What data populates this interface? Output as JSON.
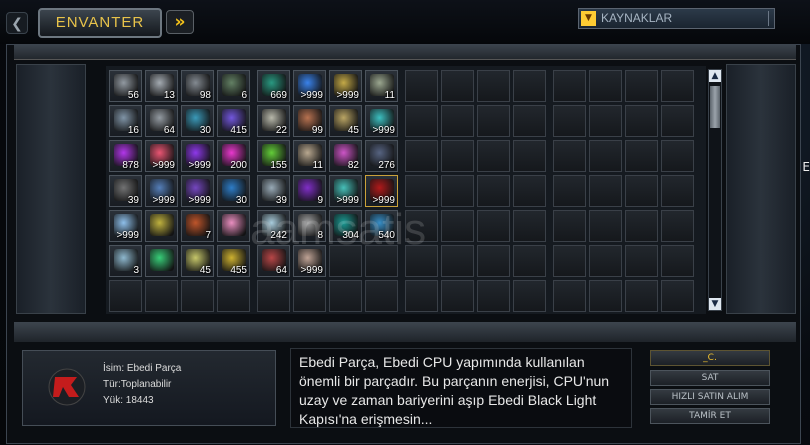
{
  "header": {
    "back_icon": "chevron-left-icon",
    "tab_label": "ENVANTER",
    "forward_icon": "double-chevron-right-icon",
    "dropdown_selected": "KAYNAKLAR"
  },
  "grid": {
    "columns": 16,
    "rows": 7,
    "items": [
      {
        "cell": 0,
        "count": "56",
        "color": "#9ea6ae"
      },
      {
        "cell": 1,
        "count": "13",
        "color": "#b2b9c0"
      },
      {
        "cell": 2,
        "count": "98",
        "color": "#8e959c"
      },
      {
        "cell": 3,
        "count": "6",
        "color": "#6a8a6a"
      },
      {
        "cell": 4,
        "count": "669",
        "color": "#2aa58a"
      },
      {
        "cell": 5,
        "count": ">999",
        "color": "#3c8cff"
      },
      {
        "cell": 6,
        "count": ">999",
        "color": "#d6b84a"
      },
      {
        "cell": 7,
        "count": "11",
        "color": "#a8b59a"
      },
      {
        "cell": 16,
        "count": "16",
        "color": "#8aa0b4"
      },
      {
        "cell": 17,
        "count": "64",
        "color": "#a0a7ae"
      },
      {
        "cell": 18,
        "count": "30",
        "color": "#3da6c8"
      },
      {
        "cell": 19,
        "count": "415",
        "color": "#7b5cf0"
      },
      {
        "cell": 20,
        "count": "22",
        "color": "#c8c8b8"
      },
      {
        "cell": 21,
        "count": "99",
        "color": "#c87a54"
      },
      {
        "cell": 22,
        "count": "45",
        "color": "#cbb36a"
      },
      {
        "cell": 23,
        "count": ">999",
        "color": "#3fd0d0"
      },
      {
        "cell": 32,
        "count": "878",
        "color": "#c238ff"
      },
      {
        "cell": 33,
        "count": ">999",
        "color": "#ff5a7a"
      },
      {
        "cell": 34,
        "count": ">999",
        "color": "#9a3aff"
      },
      {
        "cell": 35,
        "count": "200",
        "color": "#ff3ae0"
      },
      {
        "cell": 36,
        "count": "155",
        "color": "#6adf3a"
      },
      {
        "cell": 37,
        "count": "11",
        "color": "#c9b69a"
      },
      {
        "cell": 38,
        "count": "82",
        "color": "#e05ad8"
      },
      {
        "cell": 39,
        "count": "276",
        "color": "#5c6a8a"
      },
      {
        "cell": 48,
        "count": "39",
        "color": "#7a7a7a"
      },
      {
        "cell": 49,
        "count": ">999",
        "color": "#5a88c8"
      },
      {
        "cell": 50,
        "count": ">999",
        "color": "#7e4ad0"
      },
      {
        "cell": 51,
        "count": "30",
        "color": "#2f86d8"
      },
      {
        "cell": 52,
        "count": "39",
        "color": "#a5b8c5"
      },
      {
        "cell": 53,
        "count": "9",
        "color": "#8a2fd8"
      },
      {
        "cell": 54,
        "count": ">999",
        "color": "#4ad0c8"
      },
      {
        "cell": 55,
        "count": ">999",
        "color": "#c01818",
        "selected": true
      },
      {
        "cell": 64,
        "count": ">999",
        "color": "#9ad0ff"
      },
      {
        "cell": 65,
        "count": "",
        "color": "#d0c040"
      },
      {
        "cell": 66,
        "count": "7",
        "color": "#d05a2a"
      },
      {
        "cell": 67,
        "count": "",
        "color": "#ff9ad0"
      },
      {
        "cell": 68,
        "count": "242",
        "color": "#b8dff0"
      },
      {
        "cell": 69,
        "count": "8",
        "color": "#b0b0b0"
      },
      {
        "cell": 70,
        "count": "304",
        "color": "#1aa8a0"
      },
      {
        "cell": 71,
        "count": "540",
        "color": "#3a9ad8"
      },
      {
        "cell": 80,
        "count": "3",
        "color": "#9ac8e0"
      },
      {
        "cell": 81,
        "count": "",
        "color": "#3ae080"
      },
      {
        "cell": 82,
        "count": "45",
        "color": "#d8d870"
      },
      {
        "cell": 83,
        "count": "455",
        "color": "#e0c030"
      },
      {
        "cell": 84,
        "count": "64",
        "color": "#c84a4a"
      },
      {
        "cell": 85,
        "count": ">999",
        "color": "#d0b0a0"
      }
    ]
  },
  "scrollbar": {
    "up_icon": "arrow-up-icon",
    "down_icon": "arrow-down-icon"
  },
  "info": {
    "name_line": "İsim: Ebedi Parça",
    "type_line": "Tür:Toplanabilir",
    "load_line": "Yük: 18443",
    "description": "Ebedi Parça, Ebedi CPU yapımında kullanılan önemli bir parçadır. Bu parçanın enerjisi, CPU'nun uzay ve zaman bariyerini aşıp Ebedi Black Light Kapısı'na erişmesin..."
  },
  "actions": {
    "price_label": "_C.",
    "sell": "SAT",
    "quick_buy": "HIZLI SATIN ALIM",
    "repair": "TAMİR ET"
  },
  "watermark": "aamsatis",
  "edge_char": "E"
}
